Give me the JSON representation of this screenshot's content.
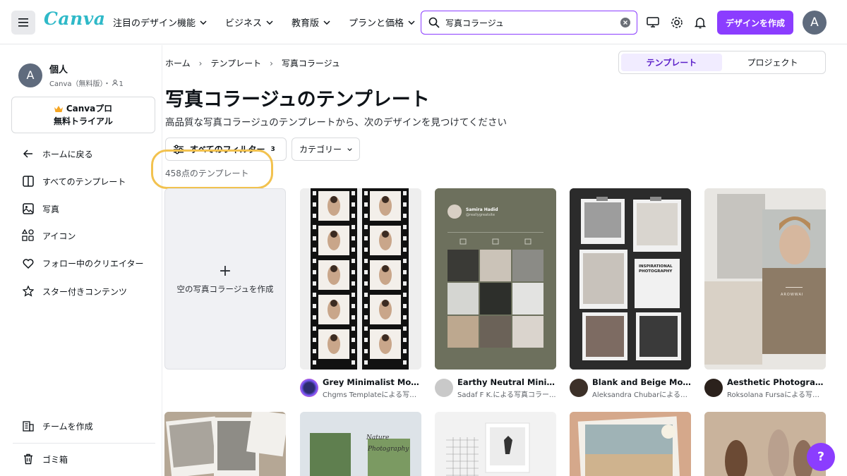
{
  "header": {
    "logo": "Canva",
    "nav": [
      {
        "label": "注目のデザイン機能"
      },
      {
        "label": "ビジネス"
      },
      {
        "label": "教育版"
      },
      {
        "label": "プランと価格"
      }
    ],
    "search_value": "写真コラージュ",
    "create_label": "デザインを作成",
    "avatar_initial": "A"
  },
  "sidebar": {
    "account_initial": "A",
    "account_name": "個人",
    "account_sub": "Canva（無料版）・",
    "account_members": "1",
    "pro_line1": "Canvaプロ",
    "pro_line2": "無料トライアル",
    "items": [
      {
        "label": "ホームに戻る",
        "icon": "arrow-left-icon"
      },
      {
        "label": "すべてのテンプレート",
        "icon": "layout-icon"
      },
      {
        "label": "写真",
        "icon": "image-icon"
      },
      {
        "label": "アイコン",
        "icon": "shapes-icon"
      },
      {
        "label": "フォロー中のクリエイター",
        "icon": "heart-icon"
      },
      {
        "label": "スター付きコンテンツ",
        "icon": "star-icon"
      }
    ],
    "bottom_items": [
      {
        "label": "チームを作成",
        "icon": "building-icon"
      },
      {
        "label": "ゴミ箱",
        "icon": "trash-icon"
      }
    ]
  },
  "main": {
    "breadcrumb": [
      "ホーム",
      "テンプレート",
      "写真コラージュ"
    ],
    "segment": {
      "active": "テンプレート",
      "other": "プロジェクト"
    },
    "title": "写真コラージュのテンプレート",
    "subtitle": "高品質な写真コラージュのテンプレートから、次のデザインを見つけてください",
    "filter_all_label": "すべてのフィルター",
    "filter_count": "3",
    "category_label": "カテゴリー",
    "result_count": "458点のテンプレート",
    "create_empty_label": "空の写真コラージュを作成",
    "templates": [
      {
        "title": "Grey Minimalist Moder...",
        "author": "Chgms Templateによる写真..."
      },
      {
        "title": "Earthy Neutral Minimal...",
        "author": "Sadaf F K.による写真コラー..."
      },
      {
        "title": "Blank and Beige Mode...",
        "author": "Aleksandra Chubarによる写..."
      },
      {
        "title": "Aesthetic Photograph...",
        "author": "Roksolana Fursaによる写真..."
      }
    ],
    "card_texts": {
      "earthy_name": "Samira Hadid",
      "earthy_handle": "@reallygreatsite",
      "blank_heading": "INSPIRATIONAL PHOTOGRAPHY",
      "aesthetic_brand": "AROWWAI",
      "nature_line1": "Nature",
      "nature_line2": "Photography"
    }
  },
  "colors": {
    "accent": "#8b3dff",
    "logo": "#2fb9c8",
    "highlight": "#f2c24f"
  },
  "help_label": "?"
}
